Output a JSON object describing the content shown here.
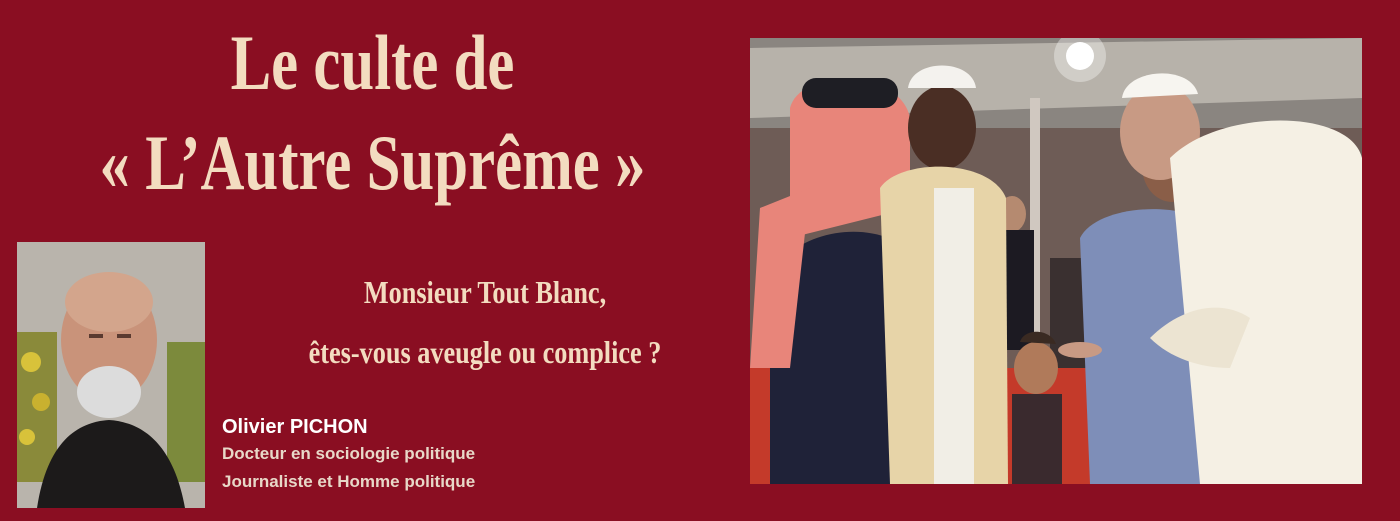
{
  "headline": {
    "line1": "Le culte de",
    "line2": "« L’Autre Suprême »"
  },
  "subtitle": {
    "line1": "Monsieur Tout Blanc,",
    "line2": "êtes-vous aveugle ou complice ?"
  },
  "author": {
    "name": "Olivier PICHON",
    "role1": "Docteur en sociologie politique",
    "role2": "Journaliste et Homme politique"
  },
  "colors": {
    "background": "#8a0e22",
    "headline": "#f3dcc0",
    "author_name": "#ffffff",
    "author_role": "#e8d8c8"
  }
}
